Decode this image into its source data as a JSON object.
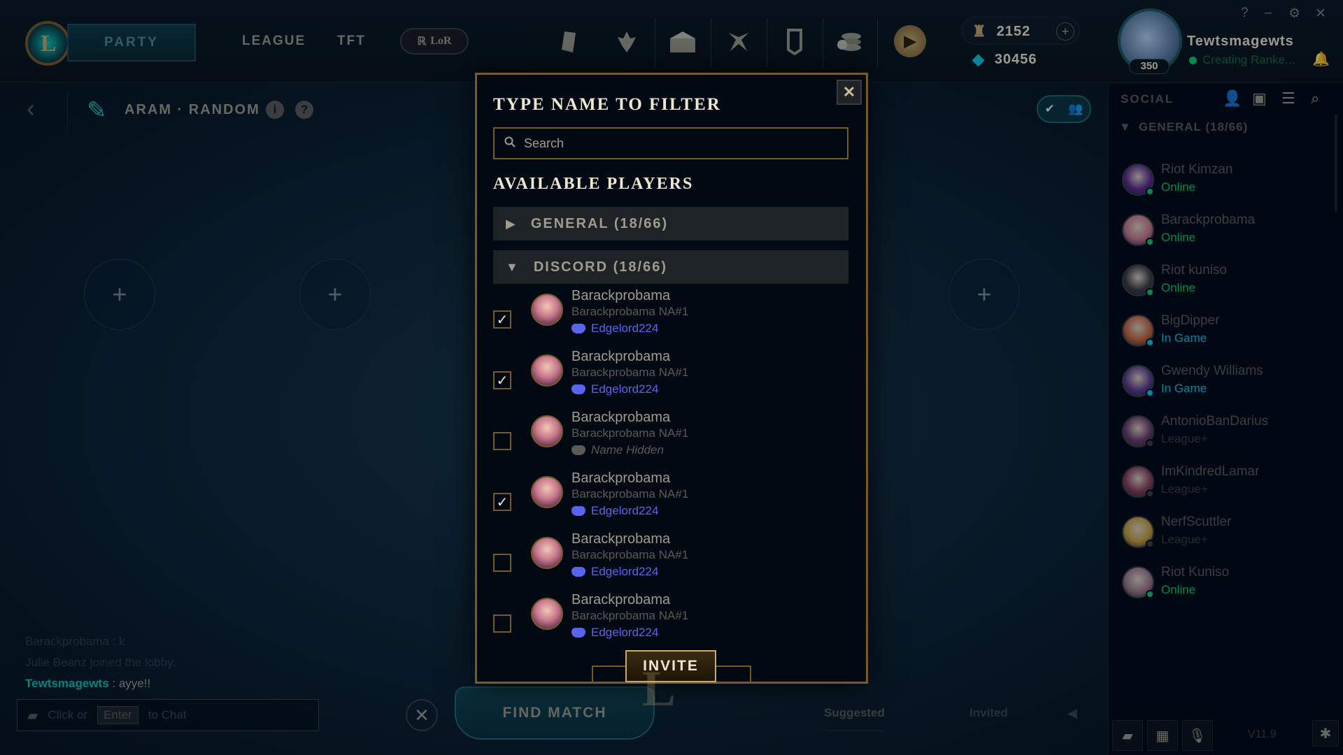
{
  "topbar": {
    "party_label": "PARTY",
    "nav": [
      "LEAGUE",
      "TFT"
    ],
    "lor_label": "LoR",
    "icons": [
      "missions-icon",
      "clash-icon",
      "loot-icon",
      "collection-icon",
      "profile-icon",
      "store-icon"
    ],
    "store_icon": "store-play-icon",
    "riot_points": "2152",
    "blue_essence": "30456",
    "profile_name": "Tewtsmagewts",
    "profile_status": "Creating Ranke...",
    "profile_level": "350",
    "window_controls": [
      "?",
      "–",
      "⚙",
      "✕"
    ]
  },
  "queue": {
    "name": "ARAM · RANDOM"
  },
  "chat": {
    "lines": [
      "Barackprobama : k",
      "Julie Beanz joined the lobby."
    ],
    "me_name": "Tewtsmagewts",
    "me_text": " : ayye!!",
    "input_prefix": "Click or",
    "input_key": "Enter",
    "input_suffix": "to Chat"
  },
  "find_match_label": "FIND MATCH",
  "bottom_tabs": [
    "Suggested",
    "Invited"
  ],
  "modal": {
    "title": "TYPE NAME TO FILTER",
    "search_placeholder": "Search",
    "available_title": "AVAILABLE PLAYERS",
    "groups": [
      {
        "label": "GENERAL (18/66)",
        "expanded": false
      },
      {
        "label": "DISCORD (18/66)",
        "expanded": true
      }
    ],
    "players": [
      {
        "name": "Barackprobama",
        "tag": "Barackprobama NA#1",
        "discord": "Edgelord224",
        "checked": true,
        "hidden": false
      },
      {
        "name": "Barackprobama",
        "tag": "Barackprobama NA#1",
        "discord": "Edgelord224",
        "checked": true,
        "hidden": false
      },
      {
        "name": "Barackprobama",
        "tag": "Barackprobama NA#1",
        "discord": "Name Hidden",
        "checked": false,
        "hidden": true
      },
      {
        "name": "Barackprobama",
        "tag": "Barackprobama NA#1",
        "discord": "Edgelord224",
        "checked": true,
        "hidden": false
      },
      {
        "name": "Barackprobama",
        "tag": "Barackprobama NA#1",
        "discord": "Edgelord224",
        "checked": false,
        "hidden": false
      },
      {
        "name": "Barackprobama",
        "tag": "Barackprobama NA#1",
        "discord": "Edgelord224",
        "checked": false,
        "hidden": false
      }
    ],
    "invite_label": "INVITE",
    "close_label": "✕"
  },
  "social": {
    "title": "SOCIAL",
    "group_label": "GENERAL (18/66)",
    "friends": [
      {
        "name": "Riot Kimzan",
        "status": "Online",
        "status_color": "#0acb6a",
        "avatar_color": "#5a2a8c"
      },
      {
        "name": "Barackprobama",
        "status": "Online",
        "status_color": "#0acb6a",
        "avatar_color": "#c8788c"
      },
      {
        "name": "Riot kuniso",
        "status": "Online",
        "status_color": "#0acb6a",
        "avatar_color": "#3c3c41"
      },
      {
        "name": "BigDipper",
        "status": "In Game",
        "status_color": "#0ac8e8",
        "avatar_color": "#c8643c"
      },
      {
        "name": "Gwendy Williams",
        "status": "In Game",
        "status_color": "#0ac8e8",
        "avatar_color": "#5a3c8c"
      },
      {
        "name": "AntonioBanDarius",
        "status": "League+",
        "status_color": "#3c3c41",
        "avatar_color": "#6a3c6a"
      },
      {
        "name": "ImKindredLamar",
        "status": "League+",
        "status_color": "#3c3c41",
        "avatar_color": "#8c3c5a"
      },
      {
        "name": "NerfScuttler",
        "status": "League+",
        "status_color": "#3c3c41",
        "avatar_color": "#c8a03c"
      },
      {
        "name": "Riot Kuniso",
        "status": "Online",
        "status_color": "#0acb6a",
        "avatar_color": "#a0788c"
      }
    ],
    "version": "V11.9"
  },
  "colors": {
    "gold": "#c8aa6e",
    "teal": "#0ac8b9",
    "discord": "#5865f2"
  }
}
